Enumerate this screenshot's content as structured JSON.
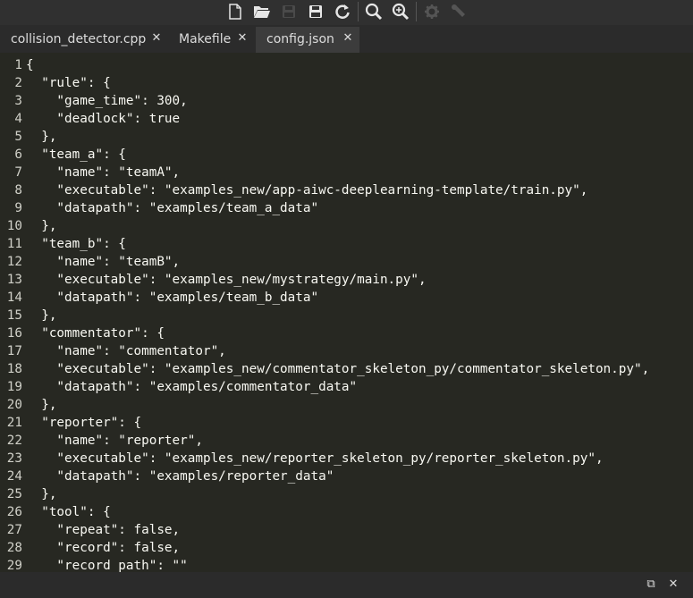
{
  "toolbar": {
    "buttons": [
      {
        "icon": "new-file-icon"
      },
      {
        "icon": "open-folder-icon"
      },
      {
        "icon": "save-icon"
      },
      {
        "icon": "save-all-icon"
      },
      {
        "icon": "reload-icon"
      },
      {
        "icon": "search-icon"
      },
      {
        "icon": "search-replace-icon"
      },
      {
        "icon": "settings-gear-icon"
      },
      {
        "icon": "wrench-icon"
      }
    ]
  },
  "tabs": [
    {
      "label": "collision_detector.cpp",
      "close": "✕",
      "active": false
    },
    {
      "label": "Makefile",
      "close": "✕",
      "active": false
    },
    {
      "label": "config.json",
      "close": "✕",
      "active": true
    }
  ],
  "editor": {
    "lines": [
      {
        "n": "1",
        "text": "{"
      },
      {
        "n": "2",
        "text": "  \"rule\": {"
      },
      {
        "n": "3",
        "text": "    \"game_time\": 300,"
      },
      {
        "n": "4",
        "text": "    \"deadlock\": true"
      },
      {
        "n": "5",
        "text": "  },"
      },
      {
        "n": "6",
        "text": "  \"team_a\": {"
      },
      {
        "n": "7",
        "text": "    \"name\": \"teamA\","
      },
      {
        "n": "8",
        "text": "    \"executable\": \"examples_new/app-aiwc-deeplearning-template/train.py\","
      },
      {
        "n": "9",
        "text": "    \"datapath\": \"examples/team_a_data\""
      },
      {
        "n": "10",
        "text": "  },"
      },
      {
        "n": "11",
        "text": "  \"team_b\": {"
      },
      {
        "n": "12",
        "text": "    \"name\": \"teamB\","
      },
      {
        "n": "13",
        "text": "    \"executable\": \"examples_new/mystrategy/main.py\","
      },
      {
        "n": "14",
        "text": "    \"datapath\": \"examples/team_b_data\""
      },
      {
        "n": "15",
        "text": "  },"
      },
      {
        "n": "16",
        "text": "  \"commentator\": {"
      },
      {
        "n": "17",
        "text": "    \"name\": \"commentator\","
      },
      {
        "n": "18",
        "text": "    \"executable\": \"examples_new/commentator_skeleton_py/commentator_skeleton.py\","
      },
      {
        "n": "19",
        "text": "    \"datapath\": \"examples/commentator_data\""
      },
      {
        "n": "20",
        "text": "  },"
      },
      {
        "n": "21",
        "text": "  \"reporter\": {"
      },
      {
        "n": "22",
        "text": "    \"name\": \"reporter\","
      },
      {
        "n": "23",
        "text": "    \"executable\": \"examples_new/reporter_skeleton_py/reporter_skeleton.py\","
      },
      {
        "n": "24",
        "text": "    \"datapath\": \"examples/reporter_data\""
      },
      {
        "n": "25",
        "text": "  },"
      },
      {
        "n": "26",
        "text": "  \"tool\": {"
      },
      {
        "n": "27",
        "text": "    \"repeat\": false,"
      },
      {
        "n": "28",
        "text": "    \"record\": false,"
      },
      {
        "n": "29",
        "text": "    \"record_path\": \"\""
      }
    ]
  },
  "statusbar": {
    "restore_label": "⧉",
    "close_label": "✕"
  }
}
